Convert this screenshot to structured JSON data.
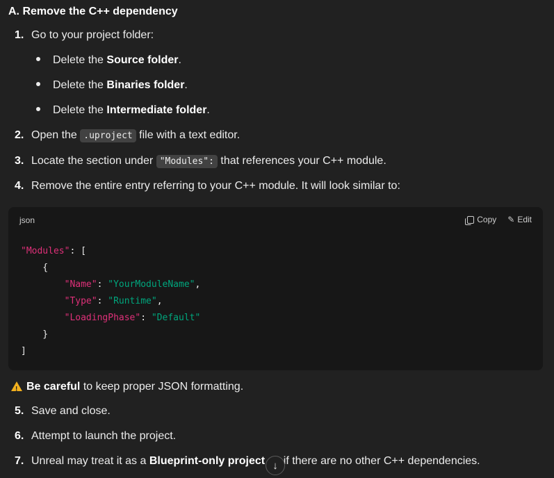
{
  "heading": "A. Remove the C++ dependency",
  "steps": {
    "s1": {
      "num": "1.",
      "text": "Go to your project folder:"
    },
    "s2": {
      "num": "2.",
      "pre": "Open the ",
      "code": ".uproject",
      "post": " file with a text editor."
    },
    "s3": {
      "num": "3.",
      "pre": "Locate the section under ",
      "code": "\"Modules\":",
      "post": " that references your C++ module."
    },
    "s4": {
      "num": "4.",
      "text": "Remove the entire entry referring to your C++ module. It will look similar to:"
    },
    "s5": {
      "num": "5.",
      "text": "Save and close."
    },
    "s6": {
      "num": "6.",
      "text": "Attempt to launch the project."
    },
    "s7": {
      "num": "7.",
      "pre": "Unreal may treat it as a ",
      "bold": "Blueprint-only project a",
      "post": "n if there are no other C++ dependencies."
    }
  },
  "bullets": [
    {
      "pre": "Delete the ",
      "bold": "Source folder",
      "post": "."
    },
    {
      "pre": "Delete the ",
      "bold": "Binaries folder",
      "post": "."
    },
    {
      "pre": "Delete the ",
      "bold": "Intermediate folder",
      "post": "."
    }
  ],
  "codeblock": {
    "language": "json",
    "copy_label": "Copy",
    "edit_label": "Edit",
    "lines": {
      "l1_key": "\"Modules\"",
      "l1_rest": ": [",
      "l2": "    {",
      "l3_key": "\"Name\"",
      "l3_sep": ": ",
      "l3_val": "\"YourModuleName\"",
      "l3_end": ",",
      "l4_key": "\"Type\"",
      "l4_sep": ": ",
      "l4_val": "\"Runtime\"",
      "l4_end": ",",
      "l5_key": "\"LoadingPhase\"",
      "l5_sep": ": ",
      "l5_val": "\"Default\"",
      "l6": "    }",
      "l7": "]"
    }
  },
  "warning": {
    "bold": "Be careful",
    "text": " to keep proper JSON formatting."
  },
  "scroll_button_glyph": "↓"
}
